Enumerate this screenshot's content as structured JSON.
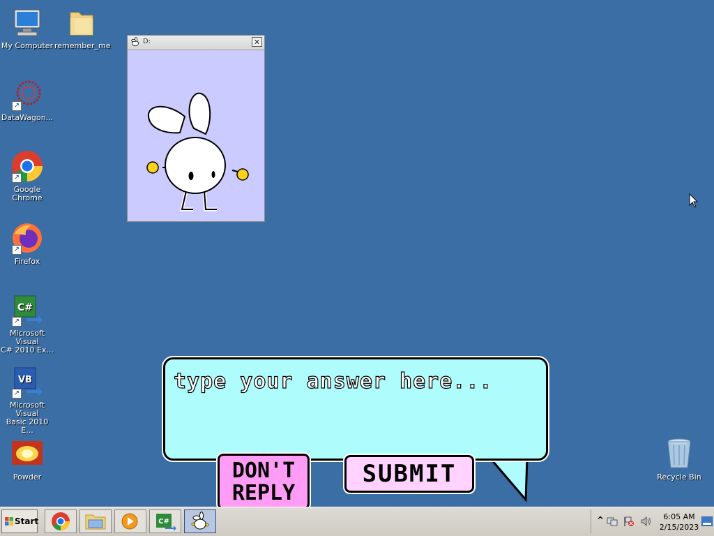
{
  "desktop": {
    "icons": [
      {
        "label": "My Computer",
        "icon": "computer-icon"
      },
      {
        "label": "remember_me",
        "icon": "folder-icon"
      },
      {
        "label": "DataWagon...",
        "icon": "datawagon-icon"
      },
      {
        "label": "Google Chrome",
        "icon": "chrome-icon"
      },
      {
        "label": "Firefox",
        "icon": "firefox-icon"
      },
      {
        "label": "Microsoft Visual\nC# 2010 Ex...",
        "icon": "csharp-icon"
      },
      {
        "label": "Microsoft Visual\nBasic 2010 E...",
        "icon": "vb-icon"
      },
      {
        "label": "Powder",
        "icon": "powder-icon"
      },
      {
        "label": "Recycle Bin",
        "icon": "recycle-bin-icon"
      }
    ]
  },
  "pet_window": {
    "title": "D:",
    "close_label": "✕"
  },
  "dialog": {
    "answer_placeholder": "type your answer here...",
    "dont_reply_label": "DON'T\nREPLY",
    "submit_label": "SUBMIT"
  },
  "taskbar": {
    "start_label": "Start",
    "apps": [
      "chrome-icon",
      "explorer-icon",
      "media-player-icon",
      "csharp-icon",
      "bunny-icon"
    ],
    "tray_expand": "^",
    "clock_time": "6:05 AM",
    "clock_date": "2/15/2023"
  },
  "colors": {
    "desktop": "#3a6ea5",
    "bubble": "#aefcfc",
    "dont_reply": "#ff9cf5",
    "submit": "#ffd2ff",
    "pet_bg": "#cbcbff"
  }
}
